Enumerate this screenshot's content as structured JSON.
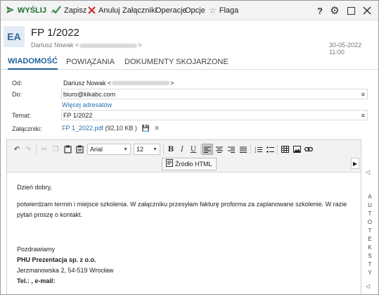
{
  "toolbar": {
    "send_label": "WYŚLIJ",
    "save_label": "Zapisz",
    "cancel_label": "Anuluj",
    "attachments_label": "Załączniki",
    "operations_label": "Operacje",
    "options_label": "Opcje",
    "flag_label": "Flaga",
    "help_label": "?"
  },
  "header": {
    "avatar_initials": "EA",
    "subject": "FP 1/2022",
    "sender_name": "Dariusz Nowak <",
    "sender_suffix": ">",
    "date": "30-05-2022 11:00"
  },
  "tabs": [
    {
      "label": "WIADOMOŚĆ",
      "active": true
    },
    {
      "label": "POWIĄZANIA",
      "active": false
    },
    {
      "label": "DOKUMENTY SKOJARZONE",
      "active": false
    }
  ],
  "form": {
    "from_label": "Od:",
    "from_value": "Dariusz Nowak <",
    "from_suffix": ">",
    "to_label": "Do:",
    "to_value": "biuro@kikabc.com",
    "more_recipients": "Więcej adresatów",
    "subject_label": "Temat:",
    "subject_value": "FP 1/2022",
    "attachments_label": "Załączniki:",
    "attachment_name": "FP 1_2022.pdf",
    "attachment_size": "(92,10 KB )"
  },
  "editor": {
    "font_family": "Arial",
    "font_size": "12",
    "source_button": "Źródło HTML",
    "body": {
      "greeting": "Dzień dobry,",
      "paragraph": "potwierdzam termin i miejsce szkolenia. W załączniku przesyłam fakturę proforma za zaplanowane szkolenie. W razie pytań proszę o kontakt.",
      "signoff": "Pozdrawiamy",
      "company": "PHU Prezentacja sp. z o.o.",
      "address": "Jerzmanowska 2, 54-519 Wrocław",
      "contact": "Tel.: , e-mail:"
    }
  },
  "side_panel": {
    "autotext_letters": [
      "A",
      "U",
      "T",
      "O",
      "T",
      "E",
      "K",
      "S",
      "T",
      "Y"
    ]
  },
  "colors": {
    "accent": "#1f5f9d",
    "send_green": "#2a7d3a",
    "cancel_red": "#d32020",
    "link_blue": "#2a6fb3"
  }
}
